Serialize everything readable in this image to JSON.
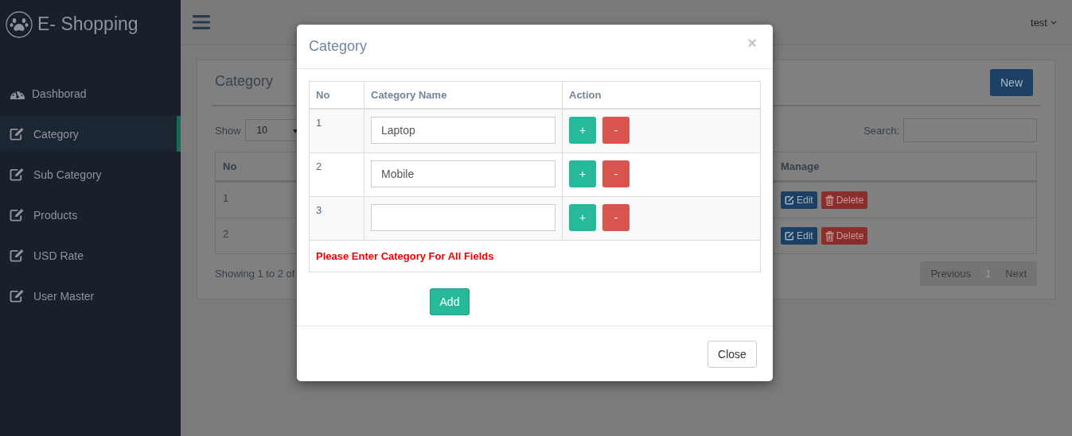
{
  "sidebar": {
    "brand": "E- Shopping",
    "items": [
      {
        "label": "Dashborad",
        "kind": "gauge",
        "selected": false
      },
      {
        "label": "Category",
        "kind": "edit",
        "selected": true
      },
      {
        "label": "Sub Category",
        "kind": "edit",
        "selected": false
      },
      {
        "label": "Products",
        "kind": "edit",
        "selected": false
      },
      {
        "label": "USD Rate",
        "kind": "edit",
        "selected": false
      },
      {
        "label": "User Master",
        "kind": "edit",
        "selected": false
      }
    ]
  },
  "topbar": {
    "user": "test"
  },
  "panel": {
    "title": "Category",
    "new_button": "New",
    "show_label": "Show",
    "page_length": "10",
    "search_label": "Search:",
    "table": {
      "columns": [
        "No",
        "Manage"
      ],
      "rows": [
        {
          "no": "1",
          "edit": "Edit",
          "delete": "Delete"
        },
        {
          "no": "2",
          "edit": "Edit",
          "delete": "Delete"
        }
      ]
    },
    "info": "Showing 1 to 2 of",
    "pagination": [
      {
        "label": "Previous",
        "selected": false
      },
      {
        "label": "1",
        "selected": true
      },
      {
        "label": "Next",
        "selected": false
      }
    ]
  },
  "modal": {
    "title": "Category",
    "close_icon": "×",
    "columns": [
      "No",
      "Category Name",
      "Action"
    ],
    "rows": [
      {
        "no": "1",
        "value": "Laptop",
        "add": "+",
        "remove": "-"
      },
      {
        "no": "2",
        "value": "Mobile",
        "add": "+",
        "remove": "-"
      },
      {
        "no": "3",
        "value": "",
        "add": "+",
        "remove": "-"
      }
    ],
    "error": "Please Enter Category For All Fields",
    "add_button": "Add",
    "close_button": "Close"
  }
}
